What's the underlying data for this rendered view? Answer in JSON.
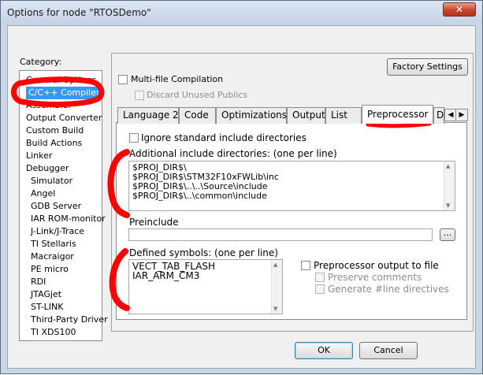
{
  "window": {
    "title": "Options for node \"RTOSDemo\"",
    "close_glyph": "✕"
  },
  "category": {
    "label": "Category:",
    "items": [
      {
        "label": "General Options",
        "indent": false,
        "selected": false
      },
      {
        "label": "C/C++ Compiler",
        "indent": false,
        "selected": true
      },
      {
        "label": "Assembler",
        "indent": false,
        "selected": false
      },
      {
        "label": "Output Converter",
        "indent": false,
        "selected": false
      },
      {
        "label": "Custom Build",
        "indent": false,
        "selected": false
      },
      {
        "label": "Build Actions",
        "indent": false,
        "selected": false
      },
      {
        "label": "Linker",
        "indent": false,
        "selected": false
      },
      {
        "label": "Debugger",
        "indent": false,
        "selected": false
      },
      {
        "label": "Simulator",
        "indent": true,
        "selected": false
      },
      {
        "label": "Angel",
        "indent": true,
        "selected": false
      },
      {
        "label": "GDB Server",
        "indent": true,
        "selected": false
      },
      {
        "label": "IAR ROM-monitor",
        "indent": true,
        "selected": false
      },
      {
        "label": "J-Link/J-Trace",
        "indent": true,
        "selected": false
      },
      {
        "label": "TI Stellaris",
        "indent": true,
        "selected": false
      },
      {
        "label": "Macraigor",
        "indent": true,
        "selected": false
      },
      {
        "label": "PE micro",
        "indent": true,
        "selected": false
      },
      {
        "label": "RDI",
        "indent": true,
        "selected": false
      },
      {
        "label": "JTAGjet",
        "indent": true,
        "selected": false
      },
      {
        "label": "ST-LINK",
        "indent": true,
        "selected": false
      },
      {
        "label": "Third-Party Driver",
        "indent": true,
        "selected": false
      },
      {
        "label": "TI XDS100",
        "indent": true,
        "selected": false
      }
    ]
  },
  "panel": {
    "factory_settings": "Factory Settings",
    "multifile": "Multi-file Compilation",
    "discard_unused": "Discard Unused Publics",
    "tabs": [
      {
        "label": "Language 2"
      },
      {
        "label": "Code"
      },
      {
        "label": "Optimizations"
      },
      {
        "label": "Output"
      },
      {
        "label": "List"
      },
      {
        "label": "Preprocessor"
      },
      {
        "label": "D"
      }
    ],
    "active_tab": "Preprocessor",
    "tab_scroll_left": "◀",
    "tab_scroll_right": "▶"
  },
  "preprocessor": {
    "ignore_std": "Ignore standard include directories",
    "include_dirs_label": "Additional include directories: (one per line)",
    "include_dirs": [
      "$PROJ_DIR$\\",
      "$PROJ_DIR$\\STM32F10xFWLib\\inc",
      "$PROJ_DIR$\\..\\..\\Source\\include",
      "$PROJ_DIR$\\..\\common\\include"
    ],
    "preinclude_label": "Preinclude",
    "preinclude_value": "",
    "browse": "...",
    "defined_label": "Defined symbols: (one per line)",
    "defined_symbols": [
      "VECT_TAB_FLASH",
      "IAR_ARM_CM3"
    ],
    "output_to_file": "Preprocessor output to file",
    "preserve_comments": "Preserve comments",
    "generate_line": "Generate #line directives"
  },
  "footer": {
    "ok": "OK",
    "cancel": "Cancel"
  },
  "colors": {
    "selection": "#3399ff",
    "annotation": "#ff0000"
  }
}
